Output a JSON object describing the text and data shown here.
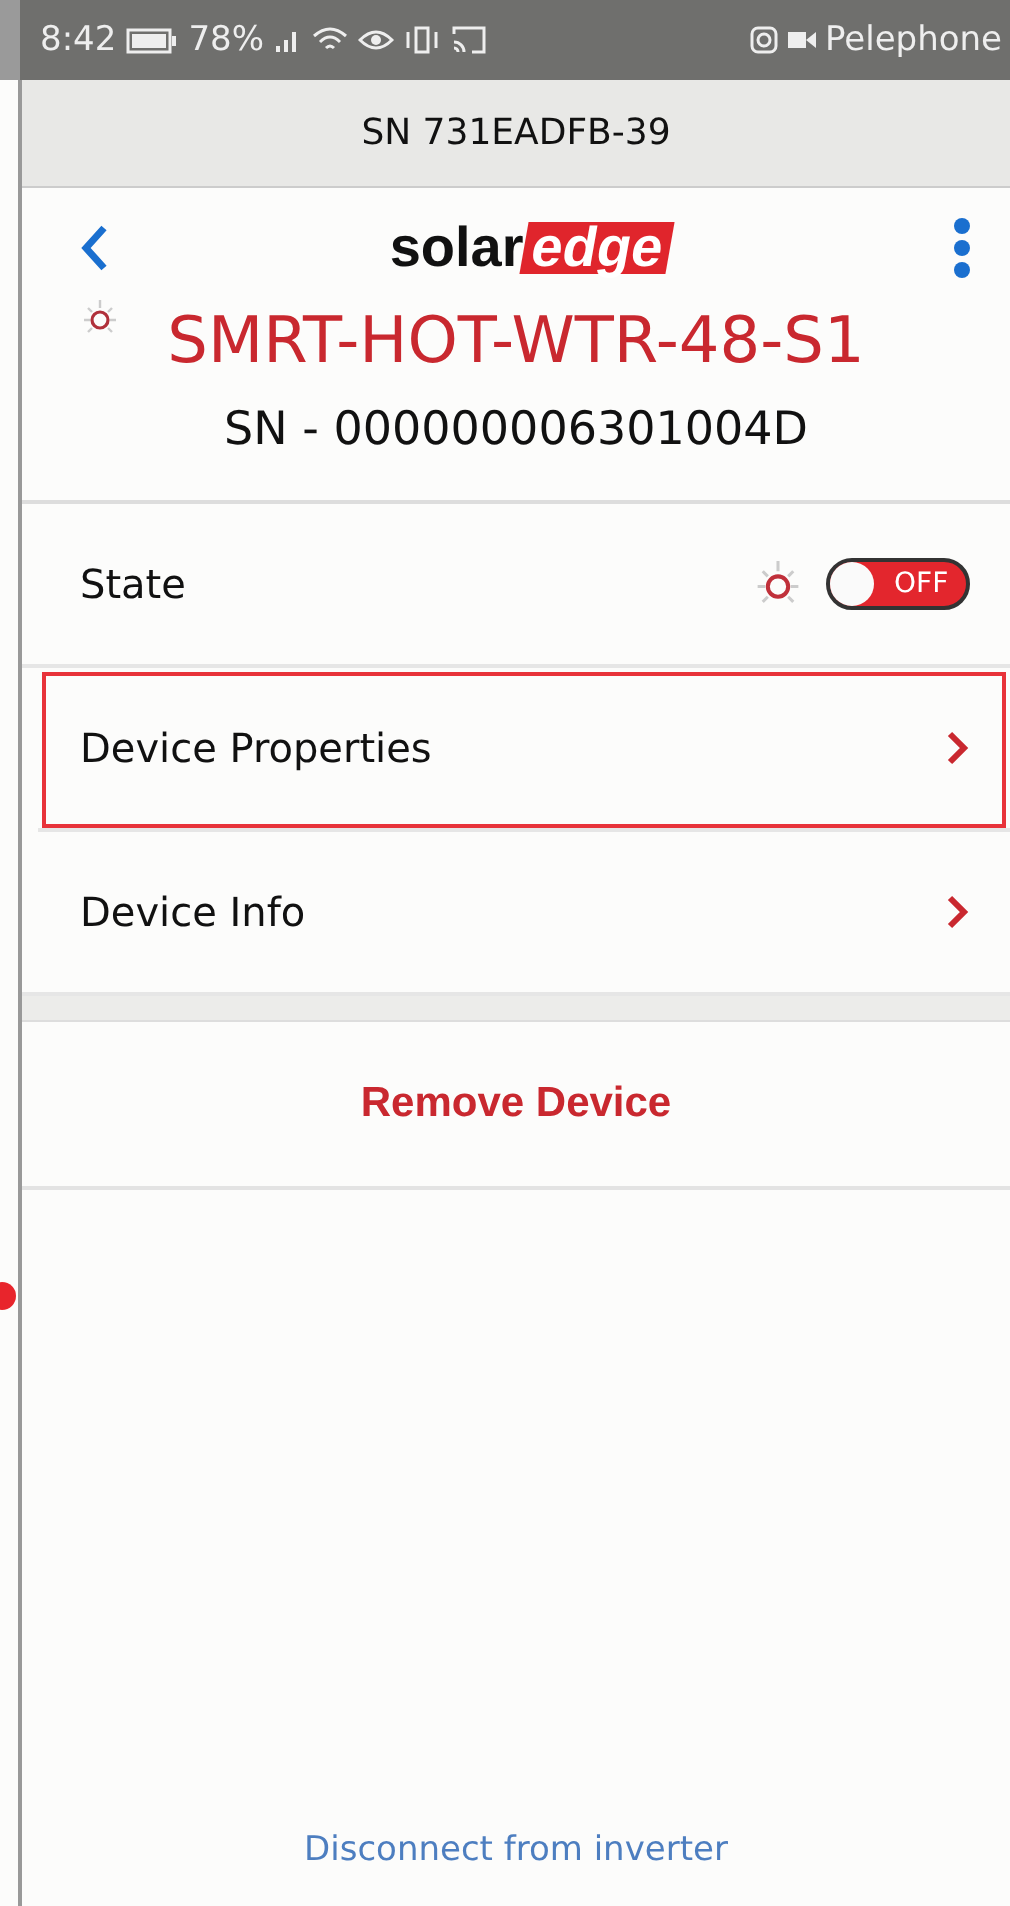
{
  "status_bar": {
    "time": "8:42",
    "battery": "78%",
    "carrier": "Pelephone"
  },
  "header": {
    "title": "SN 731EADFB-39"
  },
  "logo": {
    "part_1": "solar",
    "part_2": "edge"
  },
  "device": {
    "name": "SMRT-HOT-WTR-48-S1",
    "serial": "SN - 000000006301004D"
  },
  "state_row": {
    "label": "State",
    "on": false,
    "toggle_label": "OFF"
  },
  "menu_items": [
    {
      "label": "Device Properties",
      "highlighted": true
    },
    {
      "label": "Device Info",
      "highlighted": false
    }
  ],
  "remove_button": "Remove Device",
  "disconnect_link": "Disconnect from inverter"
}
